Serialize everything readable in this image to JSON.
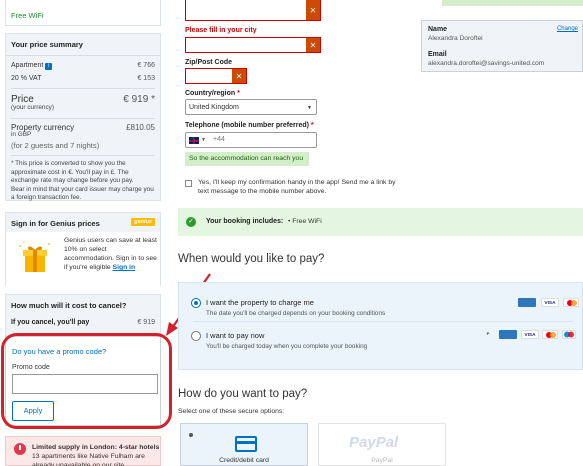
{
  "sidebar": {
    "free_wifi": "Free WiFi",
    "price_summary": {
      "title": "Your price summary",
      "apartment_label": "Apartment",
      "apartment_value": "€ 766",
      "vat_label": "20 % VAT",
      "vat_value": "€ 153",
      "price_label": "Price",
      "price_sub": "(your currency)",
      "price_value": "€ 919",
      "price_asterisk": "*",
      "property_currency_label": "Property currency",
      "property_currency_sub": "in GBP",
      "property_currency_value": "£810.05",
      "guests_nights": "(for 2 guests and 7 nights)",
      "note1": "* This price is converted to show you the approximate cost in €. You'll pay in £. The exchange rate may change before you pay.",
      "note2": "Bear in mind that your card issuer may charge you a foreign transaction fee."
    },
    "genius": {
      "title": "Sign in for Genius prices",
      "tag": "genius",
      "text": "Genius users can save at least 10% on select accommodation. Sign in to see if you're eligible",
      "link": "Sign in"
    },
    "cancel": {
      "title": "How much will it cost to cancel?",
      "label": "If you cancel, you'll pay",
      "value": "€ 919"
    },
    "promo": {
      "link": "Do you have a promo code?",
      "label": "Promo code",
      "placeholder": "",
      "apply": "Apply"
    },
    "limited": {
      "title": "Limited supply in London: 4-star hotels",
      "text": "13 apartments like Native Fulham are already unavailable on our site"
    }
  },
  "form": {
    "city_error": "Please fill in your city",
    "zip_label": "Zip/Post Code",
    "country_label": "Country/region",
    "country_value": "United Kingdom",
    "phone_label": "Telephone (mobile number preferred)",
    "phone_value": "+44",
    "phone_ok": "So the accommodation can reach you",
    "confirm_text": "Yes, I'll keep my confirmation handy in the app! Send me a link by text message to the mobile number above.",
    "required": "*",
    "error_mark": "✕"
  },
  "guest": {
    "change": "Change",
    "name_label": "Name",
    "name_value": "Alexandra Doroftei",
    "email_label": "Email",
    "email_value": "alexandra.doroftei@savings-united.com"
  },
  "includes": {
    "label": "Your booking includes:",
    "item": "• Free WiFi"
  },
  "when_pay": {
    "heading": "When would you like to pay?",
    "option1_title": "I want the property to charge me",
    "option1_sub": "The date you'll be charged depends on your booking conditions",
    "option2_title": "I want to pay now",
    "option2_sub": "You'll be charged today when you complete your booking",
    "selected": "option1"
  },
  "how_pay": {
    "heading": "How do you want to pay?",
    "sub": "Select one of these secure options:",
    "tile1": "Credit/debit card",
    "tile2": "PayPal",
    "paypal_logo": "PayPal"
  },
  "card_logos": [
    "amex",
    "visa",
    "mastercard",
    "paypal",
    "maestro"
  ],
  "colors": {
    "accent": "#0071c2",
    "error": "#cc0000",
    "success_bg": "#d3efc9",
    "annotation_red": "#d3202a"
  }
}
